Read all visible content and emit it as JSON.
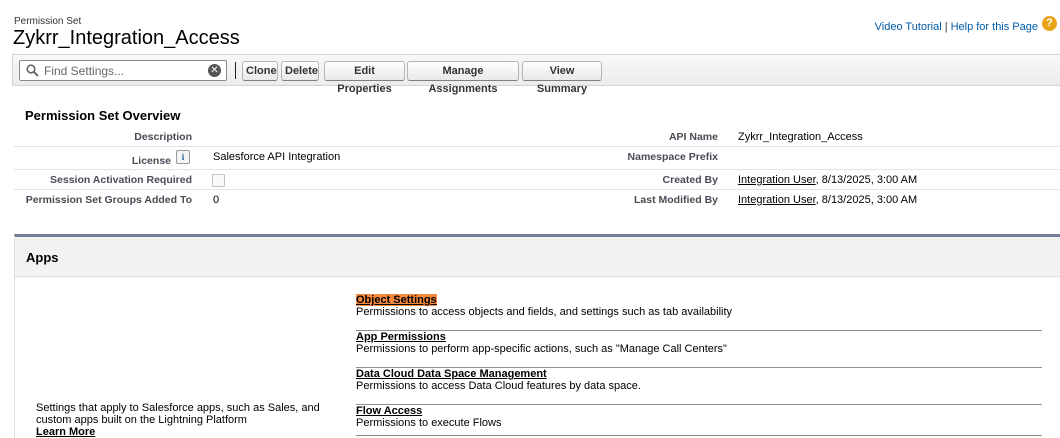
{
  "header": {
    "subtitle": "Permission Set",
    "title": "Zykrr_Integration_Access",
    "video_tutorial": "Video Tutorial",
    "separator": "|",
    "help_link": "Help for this Page",
    "help_icon": "question-mark-icon",
    "help_icon_glyph": "?",
    "help_icon_color": "#e8a317"
  },
  "toolbar": {
    "search_placeholder": "Find Settings...",
    "search_icon": "magnifier-icon",
    "clear_icon": "clear-x-icon",
    "clear_glyph": "✕",
    "buttons": [
      "Clone",
      "Delete",
      "Edit Properties",
      "Manage Assignments",
      "View Summary"
    ]
  },
  "overview": {
    "title": "Permission Set Overview",
    "description_label": "Description",
    "description_value": "",
    "api_name_label": "API Name",
    "api_name_value": "Zykrr_Integration_Access",
    "license_label": "License",
    "license_value": "Salesforce API Integration",
    "info_icon": "info-icon",
    "info_glyph": "i",
    "namespace_label": "Namespace Prefix",
    "namespace_value": "",
    "session_label": "Session Activation Required",
    "session_checked": false,
    "created_by_label": "Created By",
    "created_by_user": "Integration User",
    "created_by_date": ", 8/13/2025, 3:00 AM",
    "groups_label": "Permission Set Groups Added To",
    "groups_value": "0",
    "modified_by_label": "Last Modified By",
    "modified_by_user": "Integration User",
    "modified_by_date": ", 8/13/2025, 3:00 AM"
  },
  "apps": {
    "title": "Apps",
    "description": "Settings that apply to Salesforce apps, such as Sales, and custom apps built on the Lightning Platform",
    "learn_more": "Learn More",
    "settings": [
      {
        "label": "Object Settings",
        "desc": "Permissions to access objects and fields, and settings such as tab availability"
      },
      {
        "label": "App Permissions",
        "desc": "Permissions to perform app-specific actions, such as \"Manage Call Centers\""
      },
      {
        "label": "Data Cloud Data Space Management",
        "desc": "Permissions to access Data Cloud features by data space."
      },
      {
        "label": "Flow Access",
        "desc": "Permissions to execute Flows"
      }
    ],
    "highlight_color": "#f5893c"
  }
}
